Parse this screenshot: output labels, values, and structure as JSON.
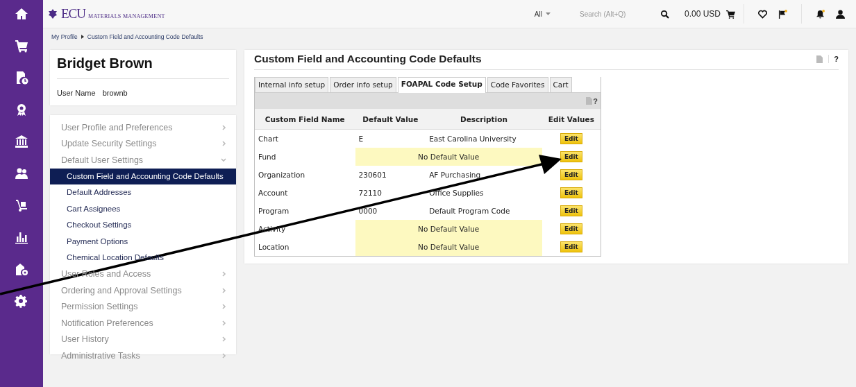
{
  "header": {
    "logo": "ECU",
    "logo_subtitle": "MATERIALS MANAGEMENT",
    "search_scope": "All",
    "search": {
      "placeholder": "Search (Alt+Q)"
    },
    "cart_total": "0.00 USD"
  },
  "breadcrumb": [
    "My Profile",
    "Custom Field and Accounting Code Defaults"
  ],
  "profile": {
    "name": "Bridget Brown",
    "username_label": "User Name",
    "username": "brownb"
  },
  "menu": [
    {
      "label": "User Profile and Preferences",
      "expanded": false
    },
    {
      "label": "Update Security Settings",
      "expanded": false
    },
    {
      "label": "Default User Settings",
      "expanded": true,
      "children": [
        {
          "label": "Custom Field and Accounting Code Defaults",
          "selected": true
        },
        {
          "label": "Default Addresses",
          "selected": false
        },
        {
          "label": "Cart Assignees",
          "selected": false
        },
        {
          "label": "Checkout Settings",
          "selected": false
        },
        {
          "label": "Payment Options",
          "selected": false
        },
        {
          "label": "Chemical Location Defaults",
          "selected": false
        }
      ]
    },
    {
      "label": "User Roles and Access",
      "expanded": false
    },
    {
      "label": "Ordering and Approval Settings",
      "expanded": false
    },
    {
      "label": "Permission Settings",
      "expanded": false
    },
    {
      "label": "Notification Preferences",
      "expanded": false
    },
    {
      "label": "User History",
      "expanded": false
    },
    {
      "label": "Administrative Tasks",
      "expanded": false
    }
  ],
  "panel": {
    "title": "Custom Field and Accounting Code Defaults",
    "help": "?",
    "tabs": [
      {
        "label": "Internal info setup",
        "selected": false
      },
      {
        "label": "Order info setup",
        "selected": false
      },
      {
        "label": "FOAPAL Code Setup",
        "selected": true
      },
      {
        "label": "Code Favorites",
        "selected": false
      },
      {
        "label": "Cart",
        "selected": false
      }
    ],
    "table": {
      "help": "?",
      "columns": [
        "Custom Field Name",
        "Default Value",
        "Description",
        "Edit Values"
      ],
      "rows": [
        {
          "field": "Chart",
          "has_default": true,
          "value": "E",
          "description": "East Carolina University",
          "action": "Edit"
        },
        {
          "field": "Fund",
          "has_default": false,
          "description": "No Default Value",
          "action": "Edit"
        },
        {
          "field": "Organization",
          "has_default": true,
          "value": "230601",
          "description": "AF Purchasing",
          "action": "Edit"
        },
        {
          "field": "Account",
          "has_default": true,
          "value": "72110",
          "description": "Office Supplies",
          "action": "Edit"
        },
        {
          "field": "Program",
          "has_default": true,
          "value": "0000",
          "description": "Default Program Code",
          "action": "Edit"
        },
        {
          "field": "Activity",
          "has_default": false,
          "description": "No Default Value",
          "action": "Edit"
        },
        {
          "field": "Location",
          "has_default": false,
          "description": "No Default Value",
          "action": "Edit"
        }
      ]
    }
  }
}
